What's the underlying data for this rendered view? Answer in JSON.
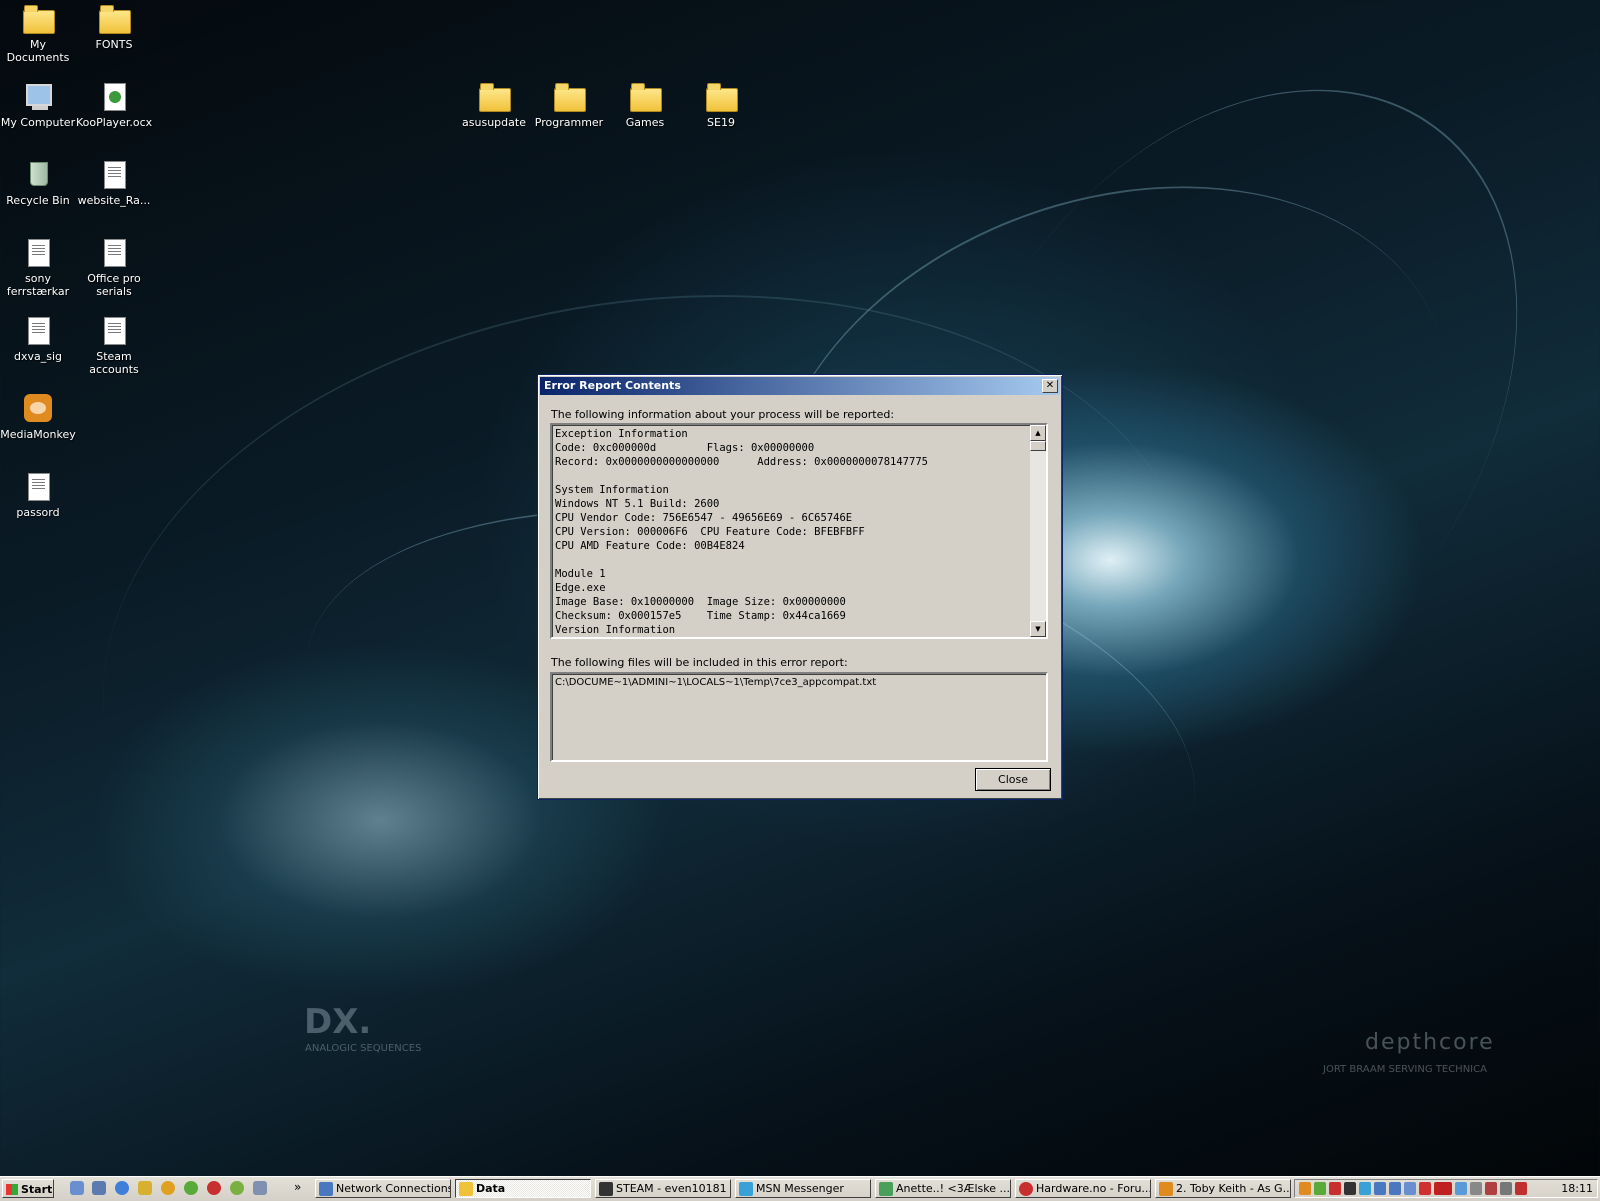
{
  "desktop": {
    "icons": [
      {
        "label": "My Documents",
        "icon": "my-documents-icon"
      },
      {
        "label": "FONTS",
        "icon": "folder-icon"
      },
      {
        "label": "My Computer",
        "icon": "my-computer-icon"
      },
      {
        "label": "KooPlayer.ocx",
        "icon": "ocx-file-icon"
      },
      {
        "label": "Recycle Bin",
        "icon": "recycle-bin-icon"
      },
      {
        "label": "website_Ra...",
        "icon": "document-icon"
      },
      {
        "label": "sony ferrstærkar",
        "icon": "text-file-icon"
      },
      {
        "label": "Office pro serials",
        "icon": "text-file-icon"
      },
      {
        "label": "dxva_sig",
        "icon": "text-file-icon"
      },
      {
        "label": "Steam accounts",
        "icon": "text-file-icon"
      },
      {
        "label": "MediaMonkey",
        "icon": "mediamonkey-icon"
      },
      {
        "label": "passord",
        "icon": "text-file-icon"
      },
      {
        "label": "asusupdate",
        "icon": "folder-icon"
      },
      {
        "label": "Programmer",
        "icon": "folder-icon"
      },
      {
        "label": "Games",
        "icon": "folder-icon"
      },
      {
        "label": "SE19",
        "icon": "folder-icon"
      }
    ],
    "wallpaper_text": {
      "dx": "DX.",
      "dx_sub": "ANALOGIC SEQUENCES",
      "brand": "depthcore",
      "credit": "JORT BRAAM SERVING TECHNICA"
    }
  },
  "dialog": {
    "title": "Error Report Contents",
    "intro": "The following information about your process will be reported:",
    "report_lines": [
      "Exception Information",
      "Code: 0xc000000d        Flags: 0x00000000",
      "Record: 0x0000000000000000      Address: 0x0000000078147775",
      "",
      "System Information",
      "Windows NT 5.1 Build: 2600",
      "CPU Vendor Code: 756E6547 - 49656E69 - 6C65746E",
      "CPU Version: 000006F6  CPU Feature Code: BFEBFBFF",
      "CPU AMD Feature Code: 00B4E824",
      "",
      "Module 1",
      "Edge.exe",
      "Image Base: 0x10000000  Image Size: 0x00000000",
      "Checksum: 0x000157e5    Time Stamp: 0x44ca1669",
      "Version Information"
    ],
    "files_label": "The following files will be included in this error report:",
    "files": "C:\\DOCUME~1\\ADMINI~1\\LOCALS~1\\Temp\\7ce3_appcompat.txt",
    "close_button": "Close"
  },
  "taskbar": {
    "start_label": "Start",
    "quicklaunch_more": "»",
    "tasks": [
      {
        "label": "Network Connections",
        "icon": "network-icon",
        "active": false
      },
      {
        "label": "Data",
        "icon": "folder-icon",
        "active": true
      },
      {
        "label": "STEAM - even10181",
        "icon": "steam-icon",
        "active": false
      },
      {
        "label": "MSN Messenger",
        "icon": "msn-icon",
        "active": false
      },
      {
        "label": "Anette..! <3Ælske ...",
        "icon": "msn-chat-icon",
        "active": false
      },
      {
        "label": "Hardware.no - Foru...",
        "icon": "opera-icon",
        "active": false
      },
      {
        "label": "2. Toby Keith - As G...",
        "icon": "mediamonkey-icon",
        "active": false
      }
    ],
    "clock": "18:11"
  }
}
